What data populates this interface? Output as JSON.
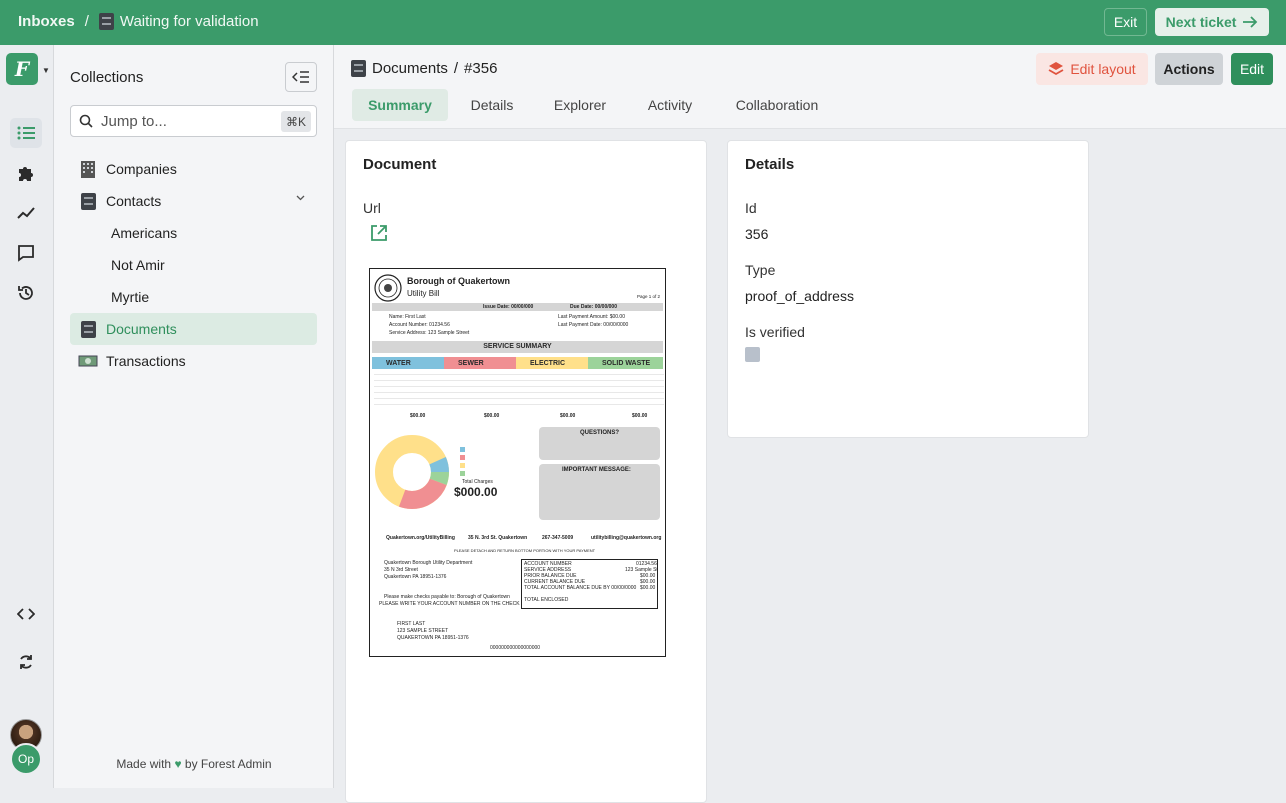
{
  "topbar": {
    "inboxes": "Inboxes",
    "separator": "/",
    "inbox_name": "Waiting for validation",
    "exit_label": "Exit",
    "next_ticket_label": "Next ticket"
  },
  "sidebar": {
    "title": "Collections",
    "search_placeholder": "Jump to...",
    "search_shortcut": "⌘K",
    "items": [
      {
        "label": "Companies",
        "icon": "building-icon"
      },
      {
        "label": "Contacts",
        "icon": "cabinet-icon",
        "expanded": true
      },
      {
        "label": "Americans"
      },
      {
        "label": "Not Amir"
      },
      {
        "label": "Myrtie"
      },
      {
        "label": "Documents",
        "icon": "cabinet-icon",
        "active": true
      },
      {
        "label": "Transactions",
        "icon": "money-icon"
      }
    ],
    "footer_made_with": "Made with",
    "footer_by": "by Forest Admin"
  },
  "rail": {
    "user_initials": "Op"
  },
  "header": {
    "collection": "Documents",
    "separator": "/",
    "record": "#356",
    "edit_layout_label": "Edit layout",
    "actions_label": "Actions",
    "edit_label": "Edit",
    "tabs": [
      "Summary",
      "Details",
      "Explorer",
      "Activity",
      "Collaboration"
    ],
    "active_tab": "Summary"
  },
  "document_card": {
    "title": "Document",
    "url_label": "Url"
  },
  "details_card": {
    "title": "Details",
    "id_label": "Id",
    "id_value": "356",
    "type_label": "Type",
    "type_value": "proof_of_address",
    "verified_label": "Is verified",
    "verified_value": false
  },
  "bill": {
    "org": "Borough of Quakertown",
    "doc_type": "Utility Bill",
    "page": "Page 1 of 2",
    "issue_date": "Issue Date: 00/00/000",
    "due_date": "Due Date: 00/00/000",
    "name": "Name: First Last",
    "account": "Account Number: 01234.56",
    "service_address": "Service Address: 123 Sample Street",
    "last_payment_amount": "Last Payment Amount: $00.00",
    "last_payment_date": "Last Payment Date: 00/00/0000",
    "summary_title": "SERVICE SUMMARY",
    "water": "WATER",
    "sewer": "SEWER",
    "electric": "ELECTRIC",
    "solid_waste": "SOLID WASTE",
    "total_water": "$00.00",
    "total_sewer": "$00.00",
    "total_electric": "$00.00",
    "total_solid": "$00.00",
    "total_label": "Total Charges",
    "total": "$000.00",
    "questions": "QUESTIONS?",
    "important": "IMPORTANT MESSAGE:",
    "web": "Quakertown.org/UtilityBilling",
    "street": "35 N. 3rd St. Quakertown",
    "phone": "267-347-5009",
    "email": "utilitybilling@quakertown.org",
    "detach": "PLEASE DETACH AND RETURN BOTTOM PORTION WITH YOUR PAYMENT",
    "dept": "Quakertown Borough Utility Department",
    "dept_street": "35 N 3rd Street",
    "dept_city": "Quakertown PA 18951-1376",
    "payable": "Please make checks payable to: Borough of Quakertown",
    "write_account": "PLEASE WRITE YOUR ACCOUNT NUMBER ON THE CHECK",
    "first_last": "FIRST LAST",
    "sample_street": "123 SAMPLE STREET",
    "sample_city": "QUAKERTOWN PA 18951-1376",
    "acct_number_label": "ACCOUNT NUMBER",
    "acct_number_value": "01234.56",
    "svc_address_label": "SERVICE ADDRESS",
    "svc_address_value": "123 Sample St",
    "prior_balance": "PRIOR BALANCE DUE",
    "current_balance": "CURRENT BALANCE DUE",
    "total_due": "TOTAL ACCOUNT BALANCE DUE BY 00/00/0000",
    "total_enclosed": "TOTAL ENCLOSED",
    "zero": "$00.00",
    "barcode_number": "000000000000000000"
  },
  "colors": {
    "brand": "#3b9b6a",
    "water": "#7fc1dd",
    "sewer": "#f08f92",
    "electric": "#ffe08a",
    "solid": "#9cd39a"
  }
}
